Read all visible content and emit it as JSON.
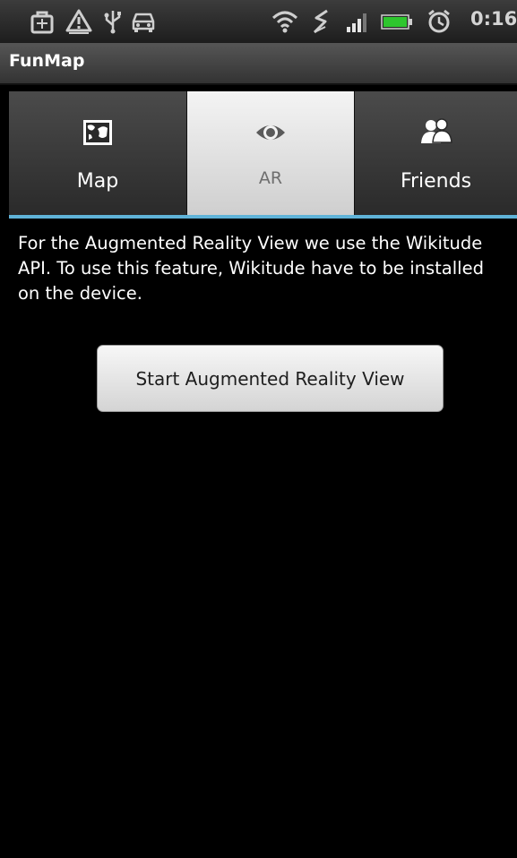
{
  "status_bar": {
    "icons": [
      "bag-icon",
      "warning-icon",
      "usb-icon",
      "car-icon",
      "wifi-icon",
      "gps-icon",
      "signal-icon",
      "battery-icon",
      "alarm-icon"
    ],
    "clock": "0:16"
  },
  "app": {
    "title": "FunMap"
  },
  "tabs": [
    {
      "label": "Map",
      "icon": "map-icon",
      "selected": false
    },
    {
      "label": "AR",
      "icon": "eye-icon",
      "selected": true
    },
    {
      "label": "Friends",
      "icon": "friends-icon",
      "selected": false
    }
  ],
  "content": {
    "description": "For the Augmented Reality View we use the Wikitude API. To use this feature, Wikitude have to be installed on the device.",
    "button_label": "Start Augmented Reality View"
  },
  "colors": {
    "accent": "#5fb3d8",
    "background": "#000000",
    "status_text": "#d4d4d4"
  }
}
